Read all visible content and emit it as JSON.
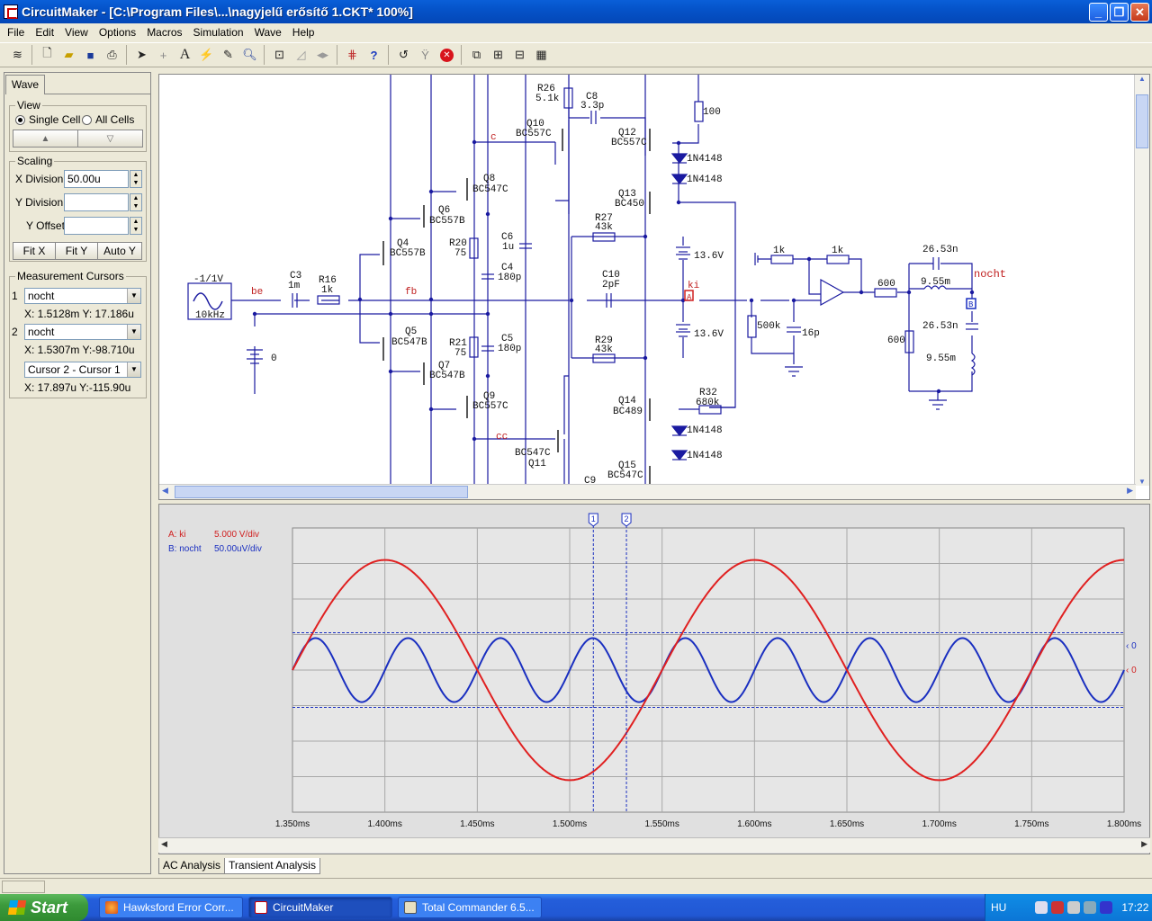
{
  "window": {
    "title": "CircuitMaker - [C:\\Program Files\\...\\nagyjelű erősítő 1.CKT* 100%]",
    "minimize": "_",
    "restore": "❐",
    "close": "✕"
  },
  "menu": [
    "File",
    "Edit",
    "View",
    "Options",
    "Macros",
    "Simulation",
    "Wave",
    "Help"
  ],
  "toolbar": {
    "icons": [
      "digital-analog-toggle-icon",
      "new-file-icon",
      "open-folder-icon",
      "save-icon",
      "print-icon",
      "arrow-pointer-icon",
      "wire-cross-icon",
      "text-tool-icon",
      "probe-icon",
      "trace-probe-icon",
      "zoom-icon",
      "zoom-to-fit-icon",
      "rotate-icon",
      "mirror-icon",
      "netlist-icon",
      "help-icon",
      "reset-icon",
      "step-icon",
      "stop-icon",
      "page-icon",
      "waveform-window-icon",
      "multi-window-icon",
      "tile-icon"
    ]
  },
  "left": {
    "tab": "Wave",
    "view": {
      "label": "View",
      "single": "Single Cell",
      "all": "All Cells",
      "up": "▲",
      "down": "▽"
    },
    "scaling": {
      "label": "Scaling",
      "xdiv_label": "X Division",
      "xdiv_value": "50.00u",
      "ydiv_label": "Y Division",
      "ydiv_value": "",
      "yoff_label": "Y Offset",
      "yoff_value": "",
      "fitx": "Fit X",
      "fity": "Fit Y",
      "autoy": "Auto Y"
    },
    "cursors": {
      "label": "Measurement Cursors",
      "c1_num": "1",
      "c1_sel": "nocht",
      "c1_read": "X: 1.5128m  Y: 17.186u",
      "c2_num": "2",
      "c2_sel": "nocht",
      "c2_read": "X: 1.5307m  Y:-98.710u",
      "diff_sel": "Cursor 2 - Cursor 1",
      "diff_read": "X: 17.897u  Y:-115.90u"
    }
  },
  "schematic": {
    "labels": {
      "src_amp": "-1/1V",
      "src_freq": "10kHz",
      "be": "be",
      "fb": "fb",
      "c": "c",
      "cc": "cc",
      "ki": "ki",
      "nocht": "nocht",
      "r16": "R16",
      "r16v": "1k",
      "c3": "C3",
      "c3v": "1m",
      "q4": "Q4",
      "q4v": "BC557B",
      "q5": "Q5",
      "q5v": "BC547B",
      "q6": "Q6",
      "q6v": "BC557B",
      "q7": "Q7",
      "q7v": "BC547B",
      "q8": "Q8",
      "q8v": "BC547C",
      "q9": "Q9",
      "q9v": "BC557C",
      "q10": "Q10",
      "q10v": "BC557C",
      "q11": "Q11",
      "q11v": "BC547C",
      "q12": "Q12",
      "q12v": "BC557C",
      "q13": "Q13",
      "q13v": "BC450",
      "q14": "Q14",
      "q14v": "BC489",
      "q15": "Q15",
      "q15v": "BC547C",
      "r20": "R20",
      "r20v": "75",
      "r21": "R21",
      "r21v": "75",
      "r26": "R26",
      "r26v": "5.1k",
      "r27": "R27",
      "r27v": "43k",
      "r29": "R29",
      "r29v": "43k",
      "r32": "R32",
      "r32v": "680k",
      "c4": "C4",
      "c4v": "180p",
      "c5": "C5",
      "c5v": "180p",
      "c6": "C6",
      "c6v": "1u",
      "c8": "C8",
      "c8v": "3.3p",
      "c9": "C9",
      "c10": "C10",
      "c10v": "2pF",
      "d1": "1N4148",
      "d2": "1N4148",
      "d3": "1N4148",
      "d4": "1N4148",
      "r100": "100",
      "bat1": "13.6V",
      "bat2": "13.6V",
      "bat0": "0",
      "r500k": "500k",
      "c16p": "16p",
      "r1k_a": "1k",
      "r1k_b": "1k",
      "r600_a": "600",
      "r600_b": "600",
      "c2653_a": "26.53n",
      "c2653_b": "26.53n",
      "l955_a": "9.55m",
      "l955_b": "9.55m",
      "probe_a": "A",
      "probe_b": "B"
    }
  },
  "wave": {
    "legend_a_name": "A: ki",
    "legend_a_scale": "5.000 V/div",
    "legend_b_name": "B: nocht",
    "legend_b_scale": "50.00uV/div",
    "cursor1": "1",
    "cursor2": "2",
    "marker_b": "0",
    "marker_a": "0",
    "xticks": [
      "1.350ms",
      "1.400ms",
      "1.450ms",
      "1.500ms",
      "1.550ms",
      "1.600ms",
      "1.650ms",
      "1.700ms",
      "1.750ms",
      "1.800ms"
    ],
    "tabs": [
      "AC Analysis",
      "Transient Analysis"
    ]
  },
  "chart_data": {
    "type": "line",
    "x_unit": "ms",
    "xlim": [
      1.35,
      1.8
    ],
    "x_division": "50.00u",
    "series": [
      {
        "name": "A: ki",
        "color": "#e02020",
        "scale": "5.000 V/div",
        "shape": "sine",
        "frequency_khz": 5,
        "amplitude_div": 3.1
      },
      {
        "name": "B: nocht",
        "color": "#1a2fc0",
        "scale": "50.00uV/div",
        "shape": "sine",
        "frequency_khz": 20,
        "amplitude_div": 0.9
      }
    ],
    "cursors": [
      {
        "label": "1",
        "x_ms": 1.5128,
        "y": "17.186u"
      },
      {
        "label": "2",
        "x_ms": 1.5307,
        "y": "-98.710u"
      }
    ]
  },
  "taskbar": {
    "start": "Start",
    "tasks": [
      "Hawksford Error Corr...",
      "CircuitMaker",
      "Total Commander 6.5..."
    ],
    "lang": "HU",
    "clock": "17:22"
  }
}
